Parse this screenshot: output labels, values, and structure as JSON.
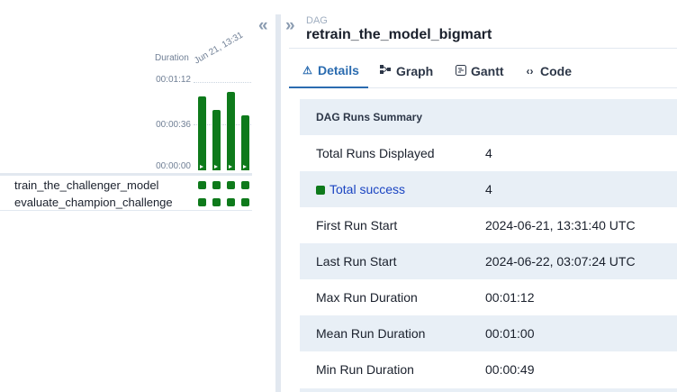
{
  "grid": {
    "collapse_icon": "double-chevron-left-icon",
    "duration_label": "Duration",
    "date_label": "Jun 21, 13:31",
    "y_ticks": [
      "00:01:12",
      "00:00:36",
      "00:00:00"
    ],
    "chart_data": {
      "type": "bar",
      "ylabel": "Duration",
      "ylim": [
        "00:00:00",
        "00:01:12"
      ],
      "values_seconds": [
        60,
        49,
        64,
        45
      ],
      "status": [
        "success",
        "success",
        "success",
        "success"
      ]
    },
    "tasks": [
      {
        "name": "train_the_challenger_model",
        "states": [
          "success",
          "success",
          "success",
          "success"
        ]
      },
      {
        "name": "evaluate_champion_challenge",
        "states": [
          "success",
          "success",
          "success",
          "success"
        ]
      }
    ],
    "colors": {
      "success": "#0e7a1b"
    }
  },
  "details": {
    "expand_icon": "double-chevron-right-icon",
    "kicker": "DAG",
    "title": "retrain_the_model_bigmart",
    "tabs": [
      {
        "label": "Details",
        "icon": "warning-triangle-icon",
        "active": true
      },
      {
        "label": "Graph",
        "icon": "graph-icon",
        "active": false
      },
      {
        "label": "Gantt",
        "icon": "gantt-icon",
        "active": false
      },
      {
        "label": "Code",
        "icon": "code-icon",
        "active": false
      }
    ],
    "summary": {
      "heading": "DAG Runs Summary",
      "rows": [
        {
          "label": "Total Runs Displayed",
          "value": "4"
        },
        {
          "label": "Total success",
          "value": "4"
        },
        {
          "label": "First Run Start",
          "value": "2024-06-21, 13:31:40 UTC"
        },
        {
          "label": "Last Run Start",
          "value": "2024-06-22, 03:07:24 UTC"
        },
        {
          "label": "Max Run Duration",
          "value": "00:01:12"
        },
        {
          "label": "Mean Run Duration",
          "value": "00:01:00"
        },
        {
          "label": "Min Run Duration",
          "value": "00:00:49"
        }
      ]
    }
  }
}
